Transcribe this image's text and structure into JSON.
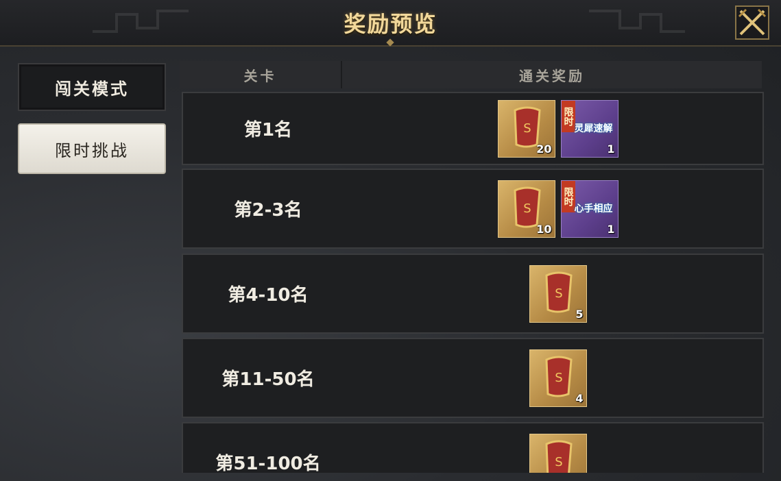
{
  "header": {
    "title": "奖励预览",
    "close_icon": "crossed-swords-close-icon"
  },
  "sidebar": {
    "items": [
      {
        "label": "闯关模式",
        "state": "selected"
      },
      {
        "label": "限时挑战",
        "state": "normal"
      }
    ]
  },
  "table": {
    "headers": [
      "关卡",
      "通关奖励"
    ],
    "rows": [
      {
        "rank": "第1名",
        "rewards": [
          {
            "icon": "red-banner-scroll-icon",
            "qty": "20"
          },
          {
            "icon": "limited-card-icon",
            "tag": "限时",
            "name": "灵犀速解",
            "qty": "1"
          }
        ]
      },
      {
        "rank": "第2-3名",
        "rewards": [
          {
            "icon": "red-banner-scroll-icon",
            "qty": "10"
          },
          {
            "icon": "limited-card-icon",
            "tag": "限时",
            "name": "心手相应",
            "qty": "1"
          }
        ]
      },
      {
        "rank": "第4-10名",
        "rewards": [
          {
            "icon": "red-banner-scroll-icon",
            "qty": "5"
          }
        ]
      },
      {
        "rank": "第11-50名",
        "rewards": [
          {
            "icon": "red-banner-scroll-icon",
            "qty": "4"
          }
        ]
      },
      {
        "rank": "第51-100名",
        "rewards": [
          {
            "icon": "red-banner-scroll-icon",
            "qty": ""
          }
        ]
      }
    ]
  },
  "colors": {
    "accent_gold": "#f2d89a",
    "tag_red": "#c23a22",
    "panel": "#1e1f21"
  }
}
